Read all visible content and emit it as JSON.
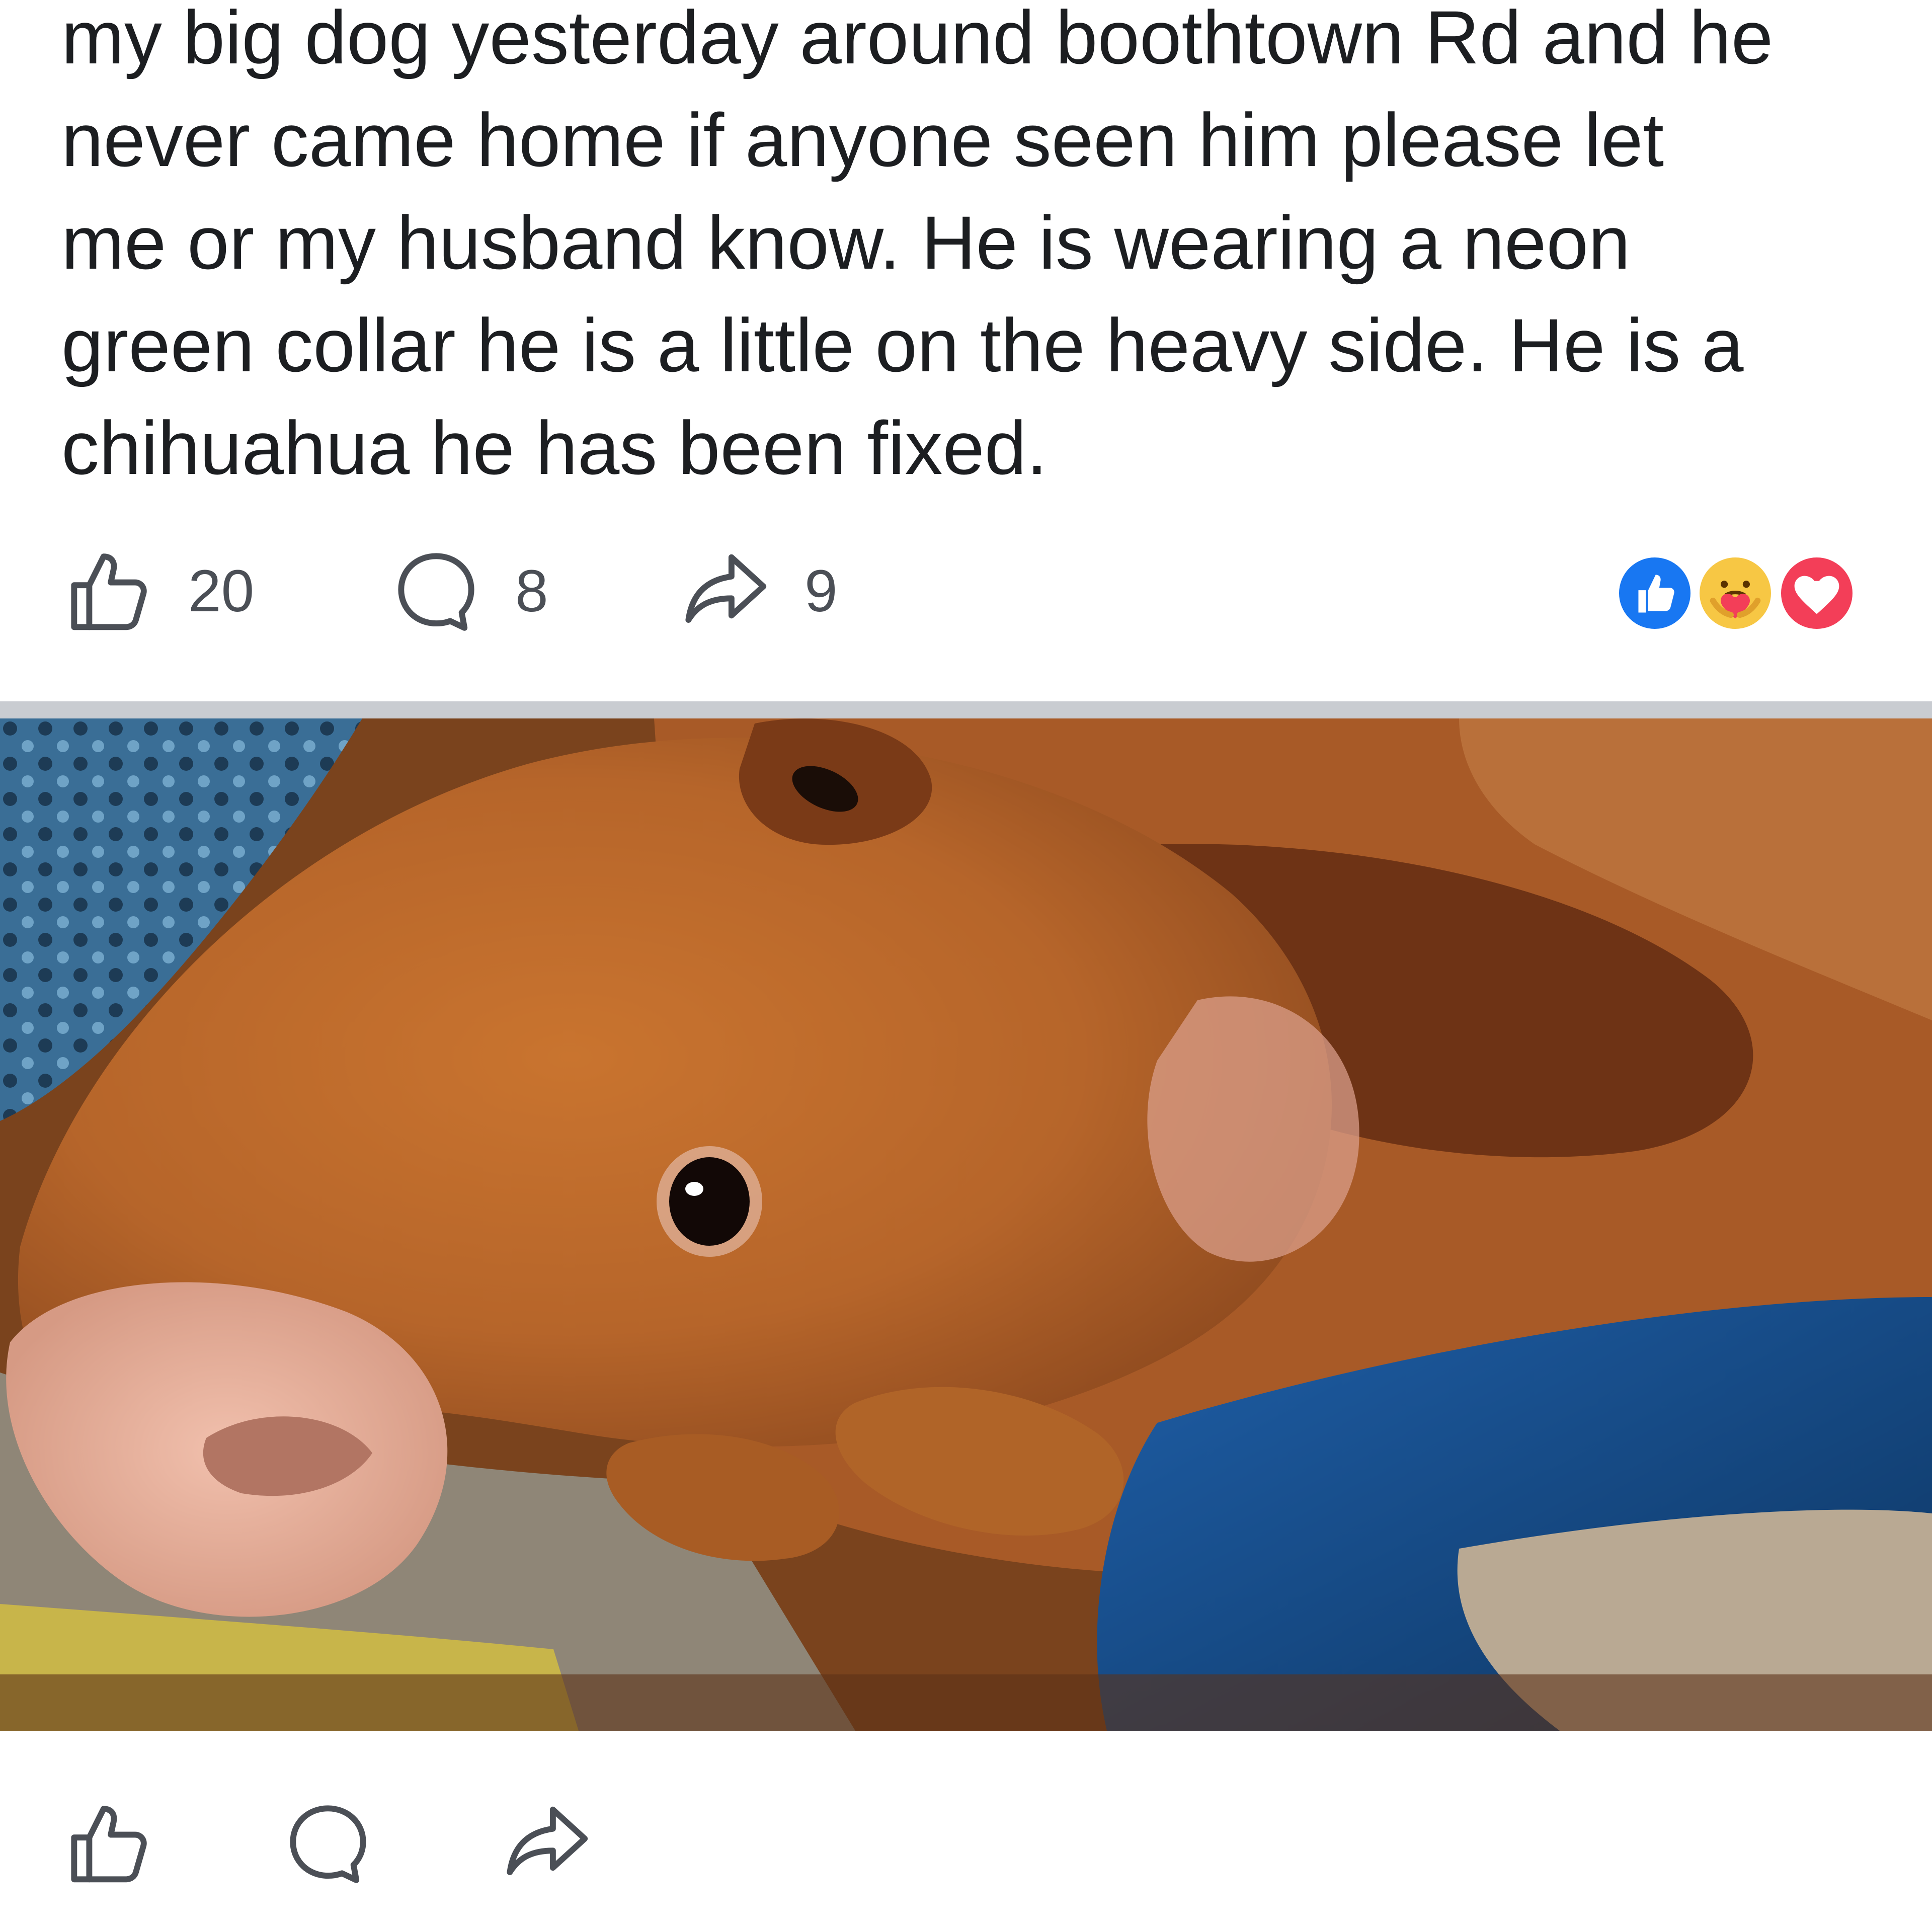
{
  "post": {
    "text_lines": [
      "my big dog yesterday around boothtown Rd and he",
      "never came home if anyone seen him please let",
      "me or my husband know. He is wearing a neon",
      "green collar he is a little on the heavy side. He is a",
      "chihuahua he has been fixed."
    ],
    "like_count": "20",
    "comment_count": "8",
    "share_count": "9",
    "reactions": [
      "like-icon",
      "care-icon",
      "love-icon"
    ]
  },
  "photo": {
    "subject": "dog-photo"
  },
  "colors": {
    "text": "#1c1e21",
    "icon": "#4b4f56",
    "like_blue": "#1877f2",
    "love_red": "#f33e58",
    "care_yellow": "#f7c744",
    "divider": "#c9ccd1"
  }
}
